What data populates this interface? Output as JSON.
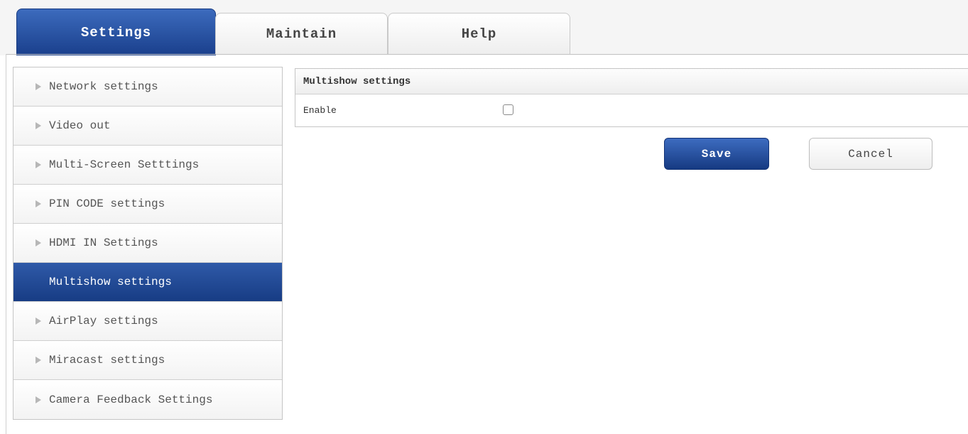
{
  "tabs": [
    {
      "label": "Settings",
      "active": true
    },
    {
      "label": "Maintain",
      "active": false
    },
    {
      "label": "Help",
      "active": false
    }
  ],
  "sidebar": {
    "items": [
      {
        "label": "Network settings",
        "active": false
      },
      {
        "label": "Video out",
        "active": false
      },
      {
        "label": "Multi-Screen Setttings",
        "active": false
      },
      {
        "label": "PIN CODE settings",
        "active": false
      },
      {
        "label": "HDMI IN Settings",
        "active": false
      },
      {
        "label": "Multishow settings",
        "active": true
      },
      {
        "label": "AirPlay settings",
        "active": false
      },
      {
        "label": "Miracast settings",
        "active": false
      },
      {
        "label": "Camera Feedback Settings",
        "active": false
      }
    ]
  },
  "panel": {
    "title": "Multishow settings",
    "enable_label": "Enable",
    "enable_checked": false
  },
  "buttons": {
    "save_label": "Save",
    "cancel_label": "Cancel"
  },
  "colors": {
    "accent": "#1f4a9a",
    "accent_light": "#3c6bbd"
  }
}
